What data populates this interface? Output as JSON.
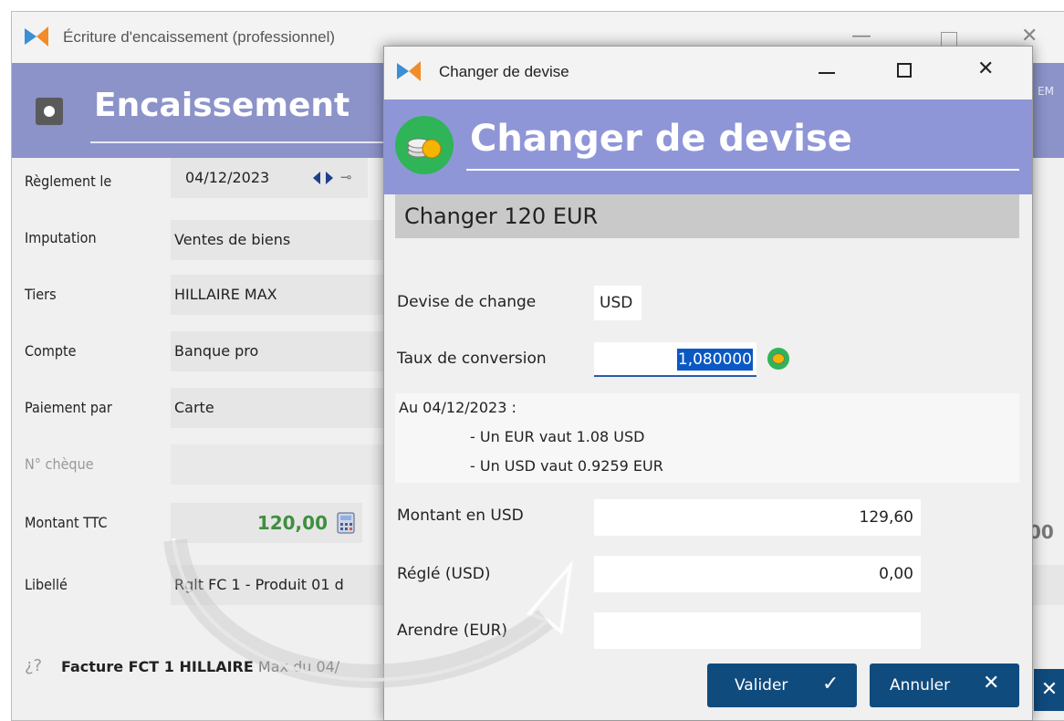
{
  "background_window": {
    "title": "Écriture d'encaissement (professionnel)",
    "header_title": "Encaissement",
    "header_right_text": "EM",
    "form": {
      "reglement_label": "Règlement le",
      "reglement_date": "04/12/2023",
      "imputation_label": "Imputation",
      "imputation_value": "Ventes de biens",
      "tiers_label": "Tiers",
      "tiers_value": "HILLAIRE MAX",
      "compte_label": "Compte",
      "compte_value": "Banque pro",
      "paiement_label": "Paiement par",
      "paiement_value": "Carte",
      "cheque_label": "N° chèque",
      "montant_label": "Montant TTC",
      "montant_value": "120,00",
      "montant_right_partial": "00",
      "libelle_label": "Libellé",
      "libelle_value": "Rglt FC 1 - Produit 01 d"
    },
    "footer_link": {
      "bold": "Facture FCT 1 HILLAIRE",
      "rest": " Max du 04/"
    }
  },
  "dialog": {
    "title": "Changer de devise",
    "header_title": "Changer de devise",
    "banner": "Changer 120 EUR",
    "devise_label": "Devise de change",
    "devise_value": "USD",
    "taux_label": "Taux de conversion",
    "taux_value": "1,080000",
    "info_date": "Au 04/12/2023 :",
    "info_line1": "- Un EUR vaut 1.08 USD",
    "info_line2": "- Un USD vaut 0.9259 EUR",
    "montant_label": "Montant en USD",
    "montant_value": "129,60",
    "regle_label": "Réglé (USD)",
    "regle_value": "0,00",
    "arendre_label": "Arendre (EUR)",
    "arendre_value": "",
    "valider_label": "Valider",
    "annuler_label": "Annuler"
  },
  "colors": {
    "header_bg": "#8f96d7",
    "button_bg": "#104b7e",
    "amount_green": "#3f8f3f",
    "coin_green": "#2fb457"
  }
}
